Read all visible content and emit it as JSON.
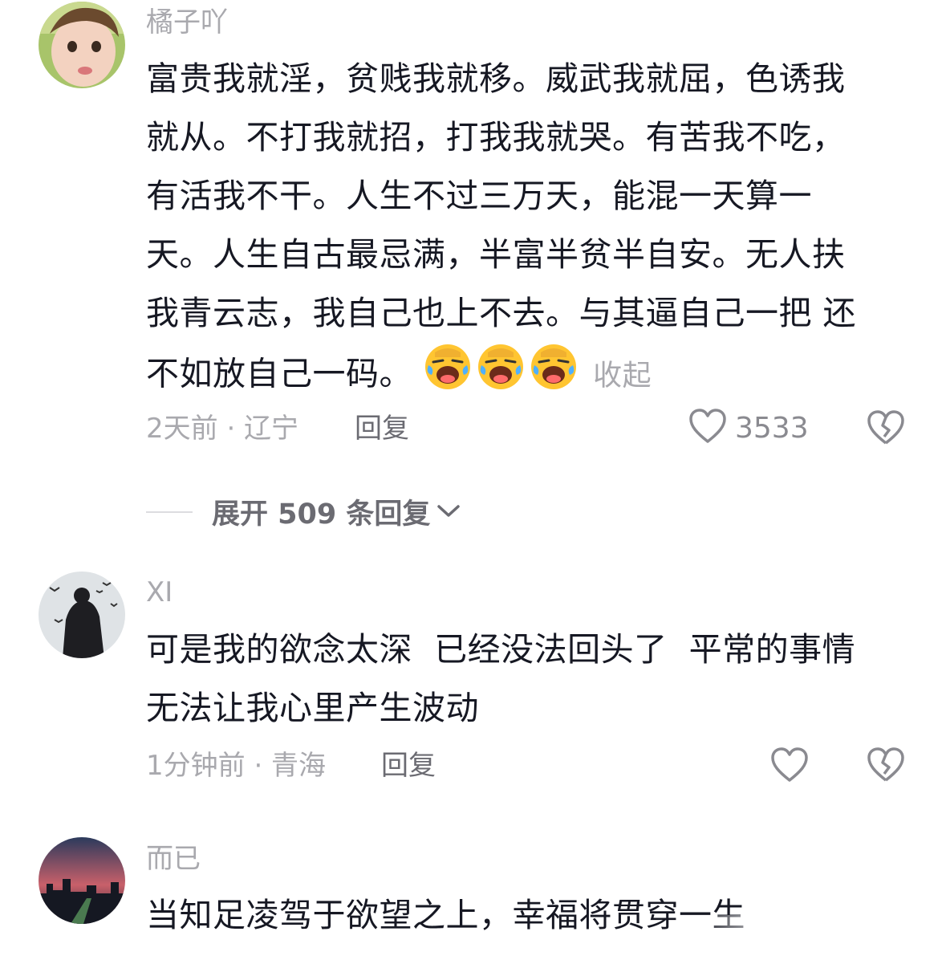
{
  "comments": [
    {
      "username": "橘子吖",
      "text_lines": [
        "富贵我就淫，贫贱我就移。威武我就屈，色诱我",
        "就从。不打我就招，打我我就哭。有苦我不吃，",
        "有活我不干。人生不过三万天，能混一天算一",
        "天。人生自古最忌满，半富半贫半自安。无人扶",
        "我青云志，我自己也上不去。与其逼自己一把 还",
        "不如放自己一码。"
      ],
      "emoji": [
        "laughing-crying-emoji",
        "laughing-crying-emoji",
        "laughing-crying-emoji"
      ],
      "collapse_label": "收起",
      "meta": "2天前 · 辽宁",
      "reply_label": "回复",
      "like_count": "3533"
    },
    {
      "username": "XI",
      "text_lines": [
        "可是我的欲念太深  已经没法回头了  平常的事情",
        "无法让我心里产生波动"
      ],
      "meta": "1分钟前 · 青海",
      "reply_label": "回复",
      "like_count": ""
    },
    {
      "username": "而已",
      "text_lines": [
        "当知足凌驾于欲望之上，幸福将贯穿一生"
      ]
    }
  ],
  "expand_replies": {
    "label": "展开 509 条回复"
  },
  "colors": {
    "text": "#161823",
    "muted": "#a9a9ae",
    "action": "#6b6b72",
    "emoji_face": "#ffc531"
  }
}
